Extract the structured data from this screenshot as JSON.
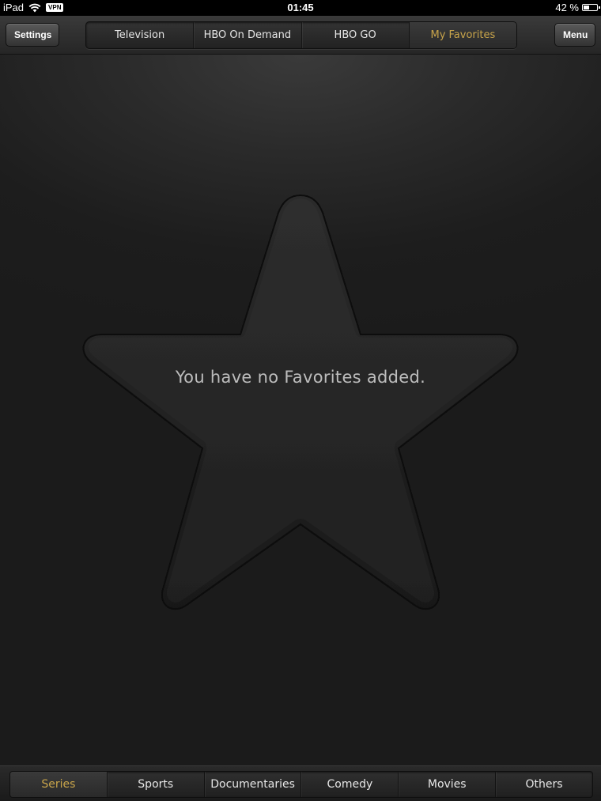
{
  "status_bar": {
    "device": "iPad",
    "vpn": "VPN",
    "time": "01:45",
    "battery_percent_label": "42 %",
    "battery_level": 0.42
  },
  "nav": {
    "settings_label": "Settings",
    "menu_label": "Menu",
    "tabs": [
      {
        "label": "Television",
        "active": false
      },
      {
        "label": "HBO On Demand",
        "active": false
      },
      {
        "label": "HBO GO",
        "active": false
      },
      {
        "label": "My Favorites",
        "active": true
      }
    ]
  },
  "main": {
    "empty_message": "You have no Favorites added.",
    "emblem_icon": "star-icon"
  },
  "categories": [
    {
      "label": "Series",
      "active": true
    },
    {
      "label": "Sports",
      "active": false
    },
    {
      "label": "Documentaries",
      "active": false
    },
    {
      "label": "Comedy",
      "active": false
    },
    {
      "label": "Movies",
      "active": false
    },
    {
      "label": "Others",
      "active": false
    }
  ],
  "colors": {
    "accent": "#c8a44a",
    "background": "#1c1c1c"
  }
}
